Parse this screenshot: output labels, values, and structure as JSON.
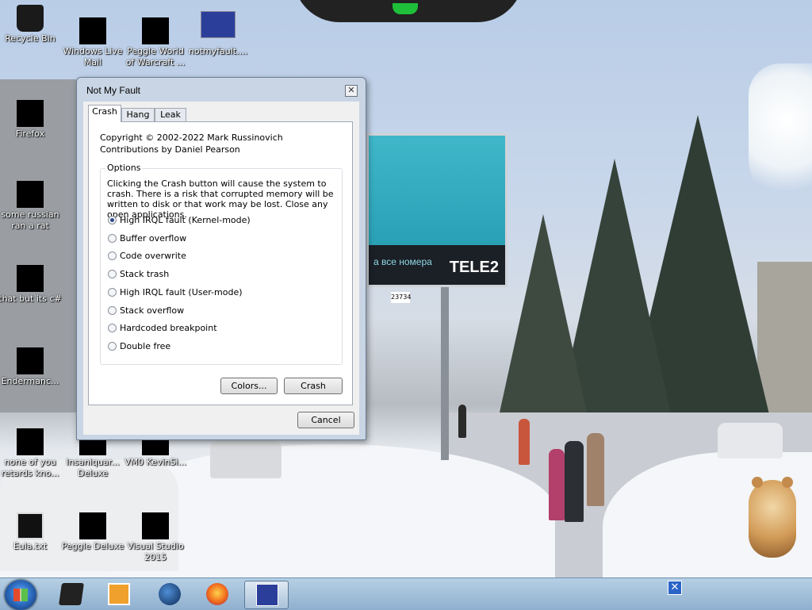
{
  "desktop_icons": [
    {
      "name": "recycle-bin",
      "label": "Recycle Bin"
    },
    {
      "name": "windows-live-mail",
      "label": "Windows Live Mail"
    },
    {
      "name": "peggle-world-of-warcraft",
      "label": "Peggle World of Warcraft ..."
    },
    {
      "name": "notmyfault",
      "label": "notmyfault...."
    },
    {
      "name": "firefox",
      "label": "Firefox"
    },
    {
      "name": "some-russian-ran-a-rat",
      "label": "some russian ran a rat"
    },
    {
      "name": "that-but-its-csharp",
      "label": "that but its c#"
    },
    {
      "name": "endermanc",
      "label": "Endermanc..."
    },
    {
      "name": "none-of-you-retards",
      "label": "none of you retards kno..."
    },
    {
      "name": "insaniquar-deluxe",
      "label": "Insaniquar... Deluxe"
    },
    {
      "name": "vm0-kevinsi",
      "label": "VM0 KevinSi..."
    },
    {
      "name": "eula-txt",
      "label": "Eula.txt"
    },
    {
      "name": "peggle-deluxe",
      "label": "Peggle Deluxe"
    },
    {
      "name": "visual-studio-2015",
      "label": "Visual Studio 2015"
    }
  ],
  "billboard": {
    "logo": "TELE2",
    "tagline": "а все номера",
    "number": "23734"
  },
  "dialog": {
    "title": "Not My Fault",
    "close_glyph": "✕",
    "tabs": [
      {
        "label": "Crash",
        "active": true
      },
      {
        "label": "Hang",
        "active": false
      },
      {
        "label": "Leak",
        "active": false
      }
    ],
    "copyright": "Copyright © 2002-2022 Mark Russinovich",
    "contributions": "Contributions by Daniel Pearson",
    "options_legend": "Options",
    "description": "Clicking the Crash button will cause the system to crash. There is a risk that corrupted memory will be written to disk or that work may be lost. Close any open applications.",
    "options": [
      {
        "label": "High IRQL fault (Kernel-mode)",
        "selected": true
      },
      {
        "label": "Buffer overflow",
        "selected": false
      },
      {
        "label": "Code overwrite",
        "selected": false
      },
      {
        "label": "Stack trash",
        "selected": false
      },
      {
        "label": "High IRQL fault (User-mode)",
        "selected": false
      },
      {
        "label": "Stack overflow",
        "selected": false
      },
      {
        "label": "Hardcoded breakpoint",
        "selected": false
      },
      {
        "label": "Double free",
        "selected": false
      }
    ],
    "colors_button": "Colors...",
    "crash_button": "Crash",
    "cancel_button": "Cancel"
  },
  "taskbar": {
    "items": [
      "start-orb",
      "black-app-icon",
      "media-player-icon",
      "globe-icon",
      "firefox-icon",
      "notmyfault-window"
    ],
    "tray_close_glyph": "✕"
  },
  "colors": {
    "taskbar": "#9fbcd9",
    "dialog_frame": "#c9d5e4",
    "radio_selected": "#2c4a8c",
    "tele2_cyan": "#3fb7c9"
  }
}
